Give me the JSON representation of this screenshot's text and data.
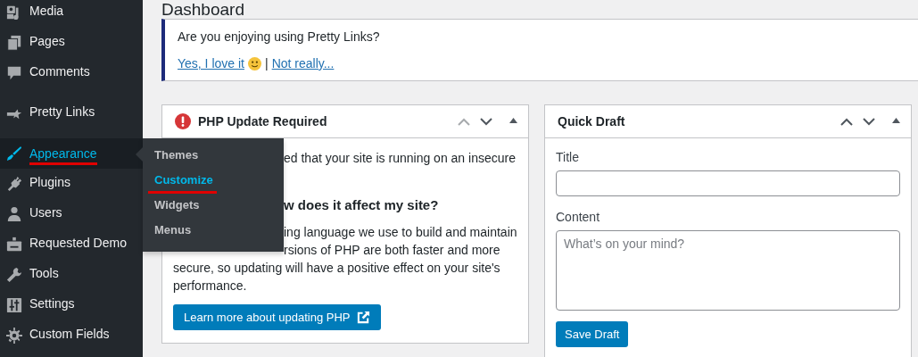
{
  "sidebar": {
    "items": [
      {
        "label": "Media",
        "selected": false,
        "underlined": false
      },
      {
        "label": "Pages",
        "selected": false,
        "underlined": false
      },
      {
        "label": "Comments",
        "selected": false,
        "underlined": false
      },
      {
        "label": "Pretty Links",
        "selected": false,
        "underlined": false
      },
      {
        "label": "Appearance",
        "selected": true,
        "underlined": true
      },
      {
        "label": "Plugins",
        "selected": false,
        "underlined": false
      },
      {
        "label": "Users",
        "selected": false,
        "underlined": false
      },
      {
        "label": "Requested Demo",
        "selected": false,
        "underlined": false
      },
      {
        "label": "Tools",
        "selected": false,
        "underlined": false
      },
      {
        "label": "Settings",
        "selected": false,
        "underlined": false
      },
      {
        "label": "Custom Fields",
        "selected": false,
        "underlined": false
      }
    ]
  },
  "submenu": {
    "items": [
      {
        "label": "Themes",
        "selected": false,
        "underlined": false
      },
      {
        "label": "Customize",
        "selected": true,
        "underlined": true
      },
      {
        "label": "Widgets",
        "selected": false,
        "underlined": false
      },
      {
        "label": "Menus",
        "selected": false,
        "underlined": false
      }
    ]
  },
  "page": {
    "title": "Dashboard"
  },
  "notice": {
    "question": "Are you enjoying using Pretty Links?",
    "yes_link": "Yes, I love it",
    "separator": "|",
    "no_link": "Not really..."
  },
  "php_panel": {
    "title": "PHP Update Required",
    "lines": [
      {
        "kind": "partial-text",
        "text": "ed that your site is running on an insecure"
      },
      {
        "kind": "partial-heading",
        "text": "w does it affect my site?"
      },
      {
        "kind": "partial-text",
        "text": "ing language we use to build and maintain"
      },
      {
        "kind": "partial-text",
        "text": "rsions of PHP are both faster and more"
      },
      {
        "kind": "text",
        "text": "secure, so updating will have a positive effect on your site's"
      },
      {
        "kind": "text",
        "text": "performance."
      }
    ],
    "button": "Learn more about updating PHP"
  },
  "quick_draft": {
    "title": "Quick Draft",
    "title_label": "Title",
    "content_label": "Content",
    "content_placeholder": "What’s on your mind?",
    "button": "Save Draft"
  }
}
